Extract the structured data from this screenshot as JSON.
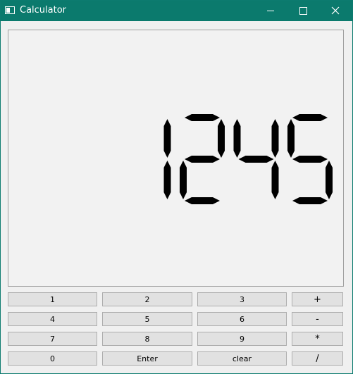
{
  "window": {
    "title": "Calculator"
  },
  "display": {
    "value": "1245"
  },
  "keypad": {
    "keys": [
      [
        "1",
        "2",
        "3",
        "+"
      ],
      [
        "4",
        "5",
        "6",
        "-"
      ],
      [
        "7",
        "8",
        "9",
        "*"
      ],
      [
        "0",
        "Enter",
        "clear",
        "/"
      ]
    ]
  },
  "colors": {
    "titlebar": "#0b7a6d",
    "display_bg": "#f2f2f2",
    "digit": "#000000",
    "button_bg": "#e1e1e1"
  },
  "icons": [
    "app-icon",
    "minimize-icon",
    "maximize-icon",
    "close-icon"
  ]
}
